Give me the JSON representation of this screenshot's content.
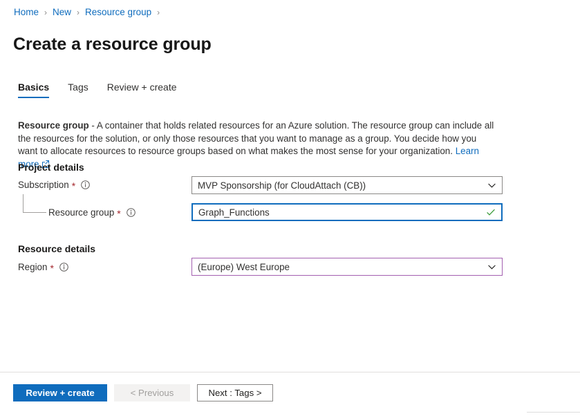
{
  "breadcrumb": {
    "items": [
      {
        "label": "Home"
      },
      {
        "label": "New"
      },
      {
        "label": "Resource group"
      }
    ],
    "separator": "›"
  },
  "page": {
    "title": "Create a resource group"
  },
  "tabs": [
    {
      "label": "Basics",
      "active": true
    },
    {
      "label": "Tags",
      "active": false
    },
    {
      "label": "Review + create",
      "active": false
    }
  ],
  "description": {
    "lead": "Resource group",
    "body": " - A container that holds related resources for an Azure solution. The resource group can include all the resources for the solution, or only those resources that you want to manage as a group. You decide how you want to allocate resources to resource groups based on what makes the most sense for your organization. ",
    "link_label": "Learn more",
    "link_icon": "external-link-icon"
  },
  "sections": {
    "project_details": {
      "heading": "Project details",
      "subscription": {
        "label": "Subscription",
        "required_marker": "*",
        "info_icon": "info-icon",
        "value": "MVP Sponsorship (for CloudAttach (CB))",
        "chevron_icon": "chevron-down-icon"
      },
      "resource_group": {
        "label": "Resource group",
        "required_marker": "*",
        "info_icon": "info-icon",
        "value": "Graph_Functions",
        "placeholder": "",
        "validation_icon": "checkmark-icon"
      }
    },
    "resource_details": {
      "heading": "Resource details",
      "region": {
        "label": "Region",
        "required_marker": "*",
        "info_icon": "info-icon",
        "value": "(Europe) West Europe",
        "chevron_icon": "chevron-down-icon"
      }
    }
  },
  "footer": {
    "review_create_label": "Review + create",
    "previous_label": "< Previous",
    "next_label": "Next : Tags >"
  },
  "colors": {
    "accent_blue": "#0f6cbd",
    "link_blue": "#0f6cbd",
    "required_red": "#a4262c",
    "valid_green": "#3b9c3b",
    "region_border_purple": "#a35fb0",
    "disabled_grey": "#f3f2f1"
  }
}
